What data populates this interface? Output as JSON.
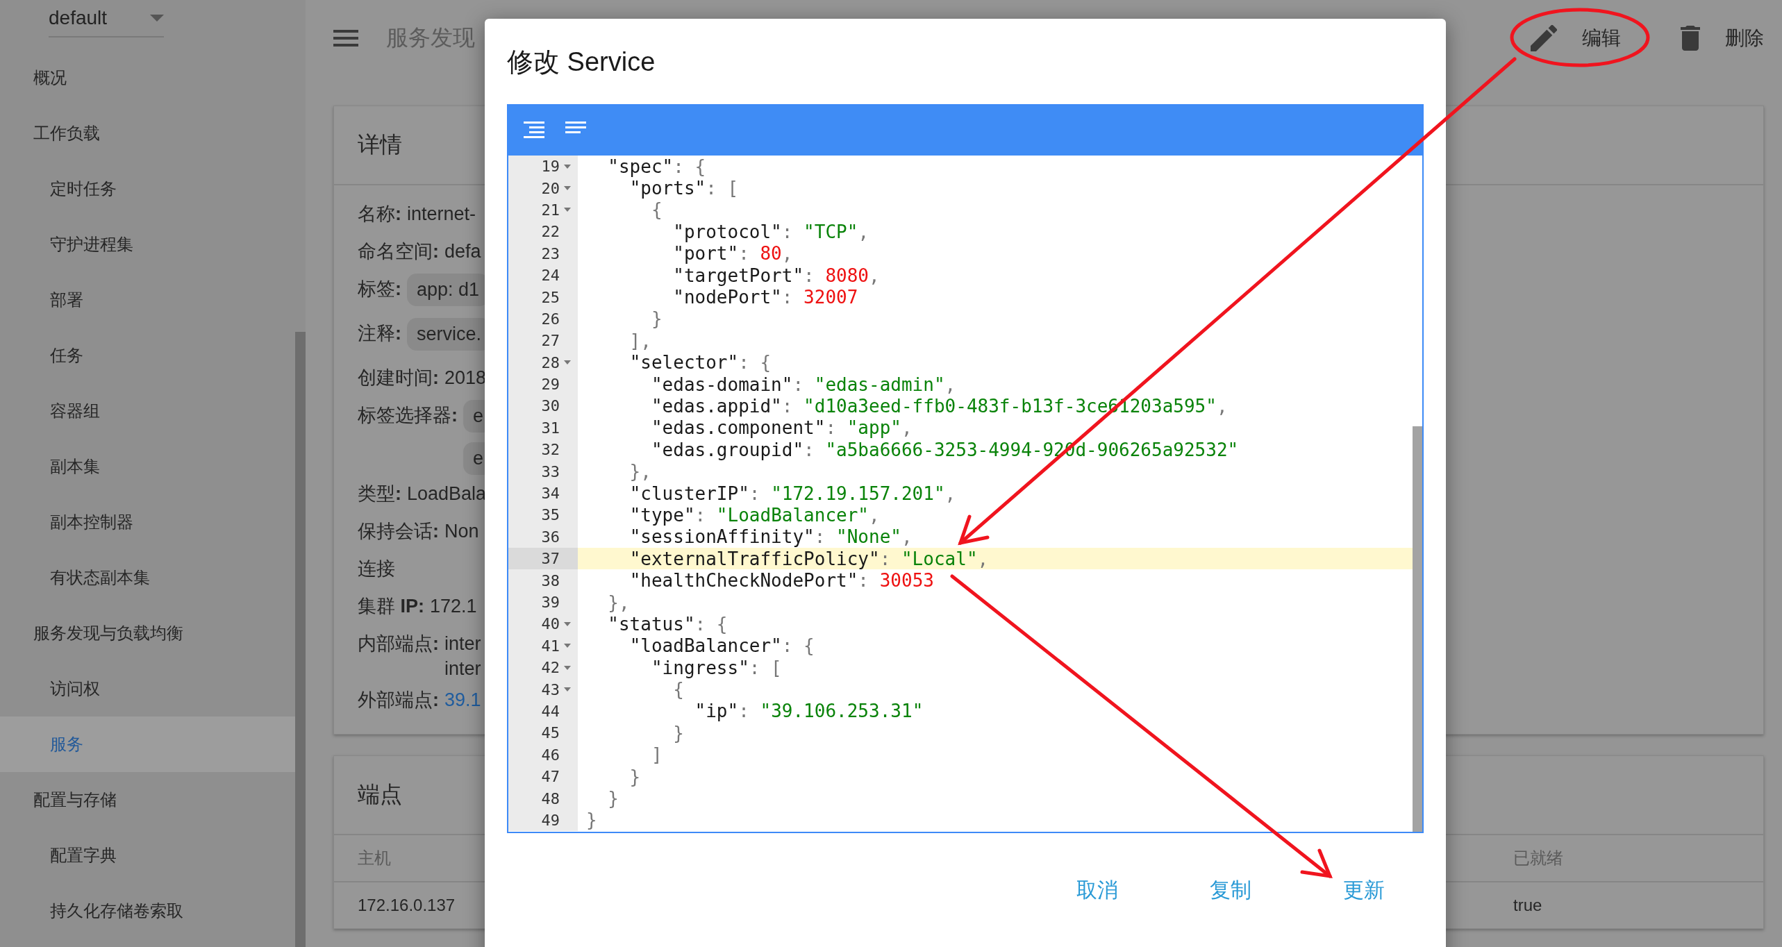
{
  "sidebar": {
    "namespace": "default",
    "items": [
      {
        "label": "概况",
        "selected": false
      },
      {
        "label": "工作负载",
        "selected": false,
        "children": [
          {
            "label": "定时任务",
            "selected": false
          },
          {
            "label": "守护进程集",
            "selected": false
          },
          {
            "label": "部署",
            "selected": false
          },
          {
            "label": "任务",
            "selected": false
          },
          {
            "label": "容器组",
            "selected": false
          },
          {
            "label": "副本集",
            "selected": false
          },
          {
            "label": "副本控制器",
            "selected": false
          },
          {
            "label": "有状态副本集",
            "selected": false
          }
        ]
      },
      {
        "label": "服务发现与负载均衡",
        "selected": false,
        "children": [
          {
            "label": "访问权",
            "selected": false
          },
          {
            "label": "服务",
            "selected": true
          }
        ]
      },
      {
        "label": "配置与存储",
        "selected": false,
        "children": [
          {
            "label": "配置字典",
            "selected": false
          },
          {
            "label": "持久化存储卷索取",
            "selected": false
          }
        ]
      }
    ]
  },
  "header": {
    "title": "服务发现",
    "actions": [
      {
        "kind": "edit",
        "label": "编辑"
      },
      {
        "kind": "delete",
        "label": "删除"
      }
    ]
  },
  "details": {
    "title": "详情",
    "fields": [
      {
        "kind": "text",
        "label": "名称**:**",
        "value": "internet-"
      },
      {
        "kind": "text",
        "label": "命名空间**:**",
        "value": "defa"
      },
      {
        "kind": "chips",
        "label": "标签**:**",
        "values": [
          "app: d1"
        ]
      },
      {
        "kind": "chips",
        "label": "注释**:**",
        "values": [
          "service."
        ]
      },
      {
        "kind": "text",
        "label": "创建时间**:**",
        "value": "2018"
      },
      {
        "kind": "chips",
        "label": "标签选择器**:**",
        "values": [
          "e",
          "e"
        ]
      },
      {
        "kind": "text",
        "label": "类型**:**",
        "value": "LoadBala"
      },
      {
        "kind": "text",
        "label": "保持会话**:**",
        "value": "Non"
      },
      {
        "kind": "heading",
        "label": "连接"
      },
      {
        "kind": "text",
        "label": "集群 **IP:**",
        "value": "172.1"
      },
      {
        "kind": "lines",
        "label": "内部端点**:**",
        "values": [
          "inter",
          "inter"
        ]
      },
      {
        "kind": "link",
        "label": "外部端点**:**",
        "value": "39.1"
      }
    ]
  },
  "endpoints": {
    "title": "端点",
    "columns": [
      "主机",
      "已就绪"
    ],
    "rows": [
      [
        "172.16.0.137",
        "true"
      ]
    ]
  },
  "dialog": {
    "title": "修改 Service",
    "lines": [
      {
        "number": "19",
        "foldable": true,
        "current": false,
        "code": "  \"spec\": {"
      },
      {
        "number": "20",
        "foldable": true,
        "current": false,
        "code": "    \"ports\": ["
      },
      {
        "number": "21",
        "foldable": true,
        "current": false,
        "code": "      {"
      },
      {
        "number": "22",
        "foldable": false,
        "current": false,
        "code": "        \"protocol\": \"TCP\","
      },
      {
        "number": "23",
        "foldable": false,
        "current": false,
        "code": "        \"port\": 80,"
      },
      {
        "number": "24",
        "foldable": false,
        "current": false,
        "code": "        \"targetPort\": 8080,"
      },
      {
        "number": "25",
        "foldable": false,
        "current": false,
        "code": "        \"nodePort\": 32007"
      },
      {
        "number": "26",
        "foldable": false,
        "current": false,
        "code": "      }"
      },
      {
        "number": "27",
        "foldable": false,
        "current": false,
        "code": "    ],"
      },
      {
        "number": "28",
        "foldable": true,
        "current": false,
        "code": "    \"selector\": {"
      },
      {
        "number": "29",
        "foldable": false,
        "current": false,
        "code": "      \"edas-domain\": \"edas-admin\","
      },
      {
        "number": "30",
        "foldable": false,
        "current": false,
        "code": "      \"edas.appid\": \"d10a3eed-ffb0-483f-b13f-3ce61203a595\","
      },
      {
        "number": "31",
        "foldable": false,
        "current": false,
        "code": "      \"edas.component\": \"app\","
      },
      {
        "number": "32",
        "foldable": false,
        "current": false,
        "code": "      \"edas.groupid\": \"a5ba6666-3253-4994-920d-906265a92532\""
      },
      {
        "number": "33",
        "foldable": false,
        "current": false,
        "code": "    },"
      },
      {
        "number": "34",
        "foldable": false,
        "current": false,
        "code": "    \"clusterIP\": \"172.19.157.201\","
      },
      {
        "number": "35",
        "foldable": false,
        "current": false,
        "code": "    \"type\": \"LoadBalancer\","
      },
      {
        "number": "36",
        "foldable": false,
        "current": false,
        "code": "    \"sessionAffinity\": \"None\","
      },
      {
        "number": "37",
        "foldable": false,
        "current": true,
        "code": "    \"externalTrafficPolicy\": \"Local\","
      },
      {
        "number": "38",
        "foldable": false,
        "current": false,
        "code": "    \"healthCheckNodePort\": 30053"
      },
      {
        "number": "39",
        "foldable": false,
        "current": false,
        "code": "  },"
      },
      {
        "number": "40",
        "foldable": true,
        "current": false,
        "code": "  \"status\": {"
      },
      {
        "number": "41",
        "foldable": true,
        "current": false,
        "code": "    \"loadBalancer\": {"
      },
      {
        "number": "42",
        "foldable": true,
        "current": false,
        "code": "      \"ingress\": ["
      },
      {
        "number": "43",
        "foldable": true,
        "current": false,
        "code": "        {"
      },
      {
        "number": "44",
        "foldable": false,
        "current": false,
        "code": "          \"ip\": \"39.106.253.31\""
      },
      {
        "number": "45",
        "foldable": false,
        "current": false,
        "code": "        }"
      },
      {
        "number": "46",
        "foldable": false,
        "current": false,
        "code": "      ]"
      },
      {
        "number": "47",
        "foldable": false,
        "current": false,
        "code": "    }"
      },
      {
        "number": "48",
        "foldable": false,
        "current": false,
        "code": "  }"
      },
      {
        "number": "49",
        "foldable": false,
        "current": false,
        "code": "}"
      }
    ],
    "buttons": [
      "取消",
      "复制",
      "更新"
    ]
  }
}
